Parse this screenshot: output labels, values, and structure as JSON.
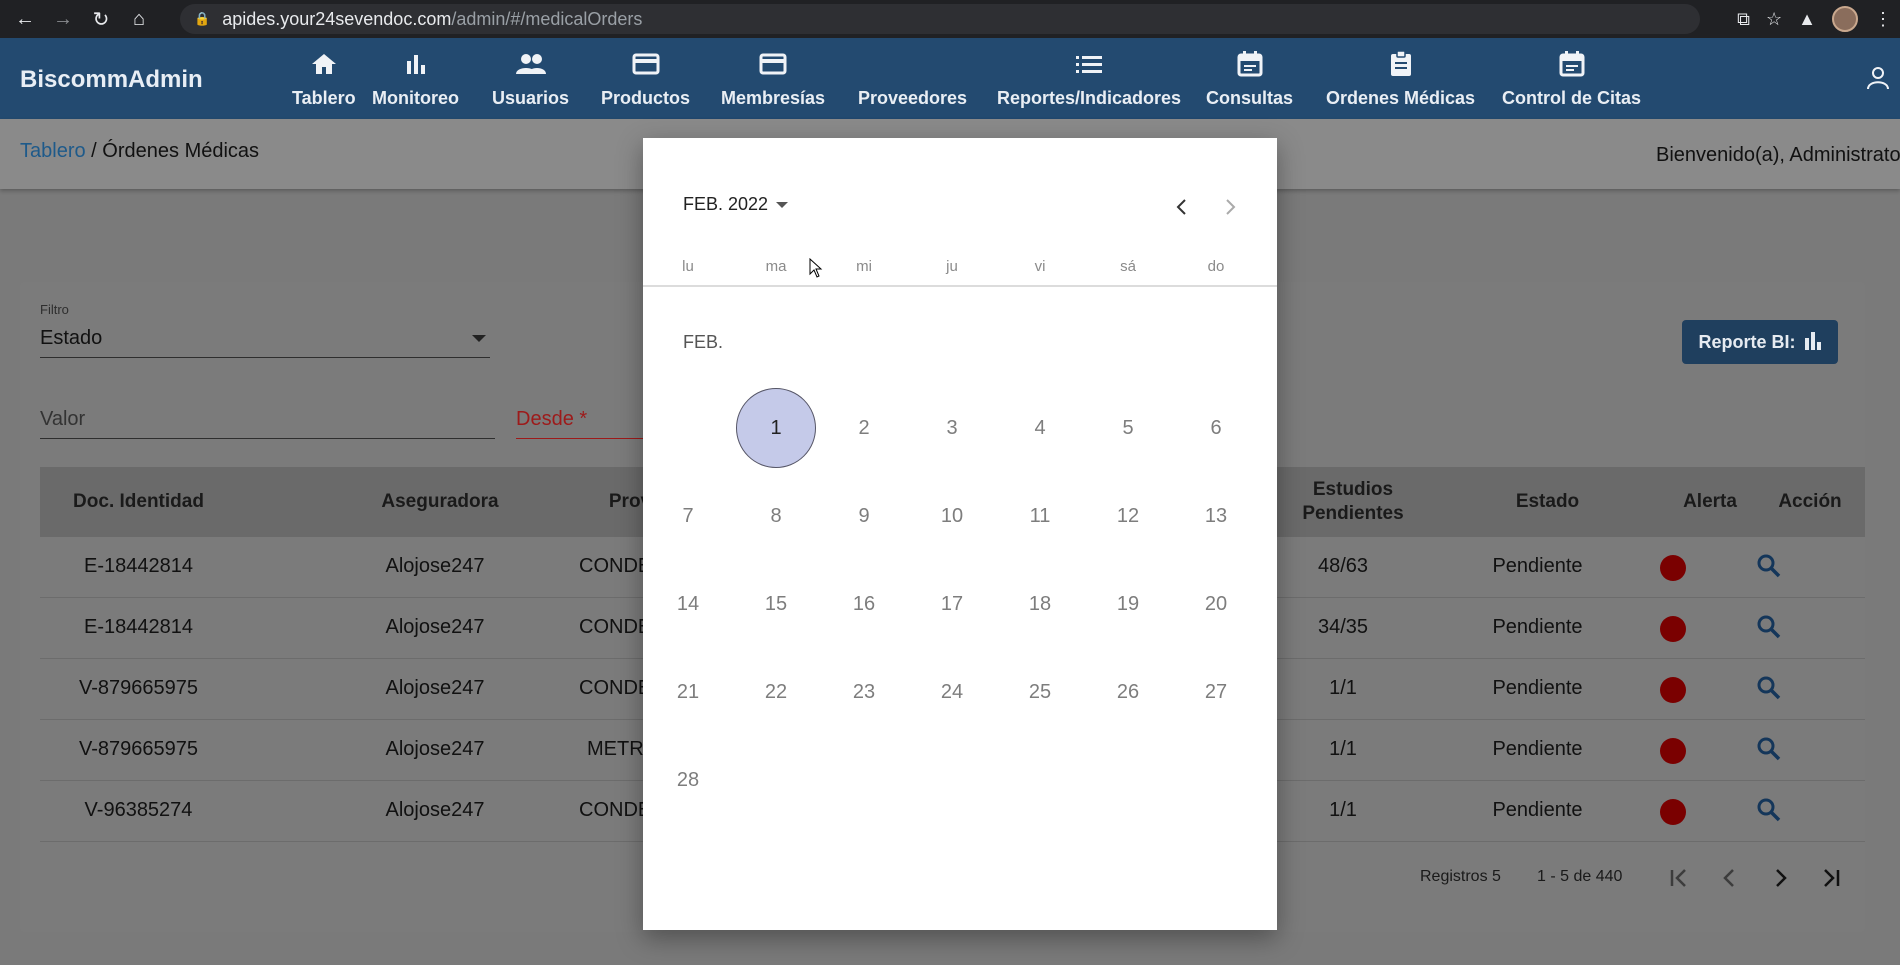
{
  "browser": {
    "url_host": "apides.your24sevendoc.com",
    "url_path": "/admin/#/medicalOrders"
  },
  "app": {
    "brand": "BiscommAdmin",
    "nav": [
      {
        "label": "Tablero",
        "icon": "home-icon"
      },
      {
        "label": "Monitoreo",
        "icon": "bar-chart-icon"
      },
      {
        "label": "Usuarios",
        "icon": "people-icon"
      },
      {
        "label": "Productos",
        "icon": "card-icon"
      },
      {
        "label": "Membresías",
        "icon": "card-icon"
      },
      {
        "label": "Proveedores",
        "icon": "list-icon"
      },
      {
        "label": "Reportes/Indicadores",
        "icon": "list-icon"
      },
      {
        "label": "Consultas",
        "icon": "calendar-icon"
      },
      {
        "label": "Ordenes Médicas",
        "icon": "clipboard-icon"
      },
      {
        "label": "Control de Citas",
        "icon": "calendar-icon"
      }
    ]
  },
  "breadcrumb": {
    "home": "Tablero",
    "separator": "/",
    "current": "Órdenes Médicas"
  },
  "welcome": "Bienvenido(a), Administrato",
  "filters": {
    "filter_label": "Filtro",
    "filter_value": "Estado",
    "valor_placeholder": "Valor",
    "desde_label": "Desde *"
  },
  "report_button": "Reporte BI:",
  "table": {
    "headers": {
      "doc": "Doc. Identidad",
      "aseguradora": "Aseguradora",
      "proveedor": "Prov",
      "estudios_1": "Estudios",
      "estudios_2": "Pendientes",
      "estado": "Estado",
      "alerta": "Alerta",
      "accion": "Acción"
    },
    "rows": [
      {
        "doc": "E-18442814",
        "aseguradora": "Alojose247",
        "proveedor": "CONDE",
        "estudios": "48/63",
        "estado": "Pendiente"
      },
      {
        "doc": "E-18442814",
        "aseguradora": "Alojose247",
        "proveedor": "CONDE",
        "estudios": "34/35",
        "estado": "Pendiente"
      },
      {
        "doc": "V-879665975",
        "aseguradora": "Alojose247",
        "proveedor": "CONDE",
        "estudios": "1/1",
        "estado": "Pendiente"
      },
      {
        "doc": "V-879665975",
        "aseguradora": "Alojose247",
        "proveedor": "METR",
        "estudios": "1/1",
        "estado": "Pendiente"
      },
      {
        "doc": "V-96385274",
        "aseguradora": "Alojose247",
        "proveedor": "CONDE",
        "estudios": "1/1",
        "estado": "Pendiente"
      }
    ]
  },
  "pagination": {
    "registros": "Registros 5",
    "range": "1 - 5 de 440"
  },
  "calendar": {
    "period_label": "FEB. 2022",
    "month_label": "FEB.",
    "weekdays": [
      "lu",
      "ma",
      "mi",
      "ju",
      "vi",
      "sá",
      "do"
    ],
    "days": [
      "1",
      "2",
      "3",
      "4",
      "5",
      "6",
      "7",
      "8",
      "9",
      "10",
      "11",
      "12",
      "13",
      "14",
      "15",
      "16",
      "17",
      "18",
      "19",
      "20",
      "21",
      "22",
      "23",
      "24",
      "25",
      "26",
      "27",
      "28"
    ],
    "first_weekday_index": 1,
    "selected_day": "1"
  },
  "colors": {
    "appbar": "#234a70",
    "selected_day": "#c5cae9",
    "alert": "#cc0000",
    "link": "#1e5a8a"
  }
}
